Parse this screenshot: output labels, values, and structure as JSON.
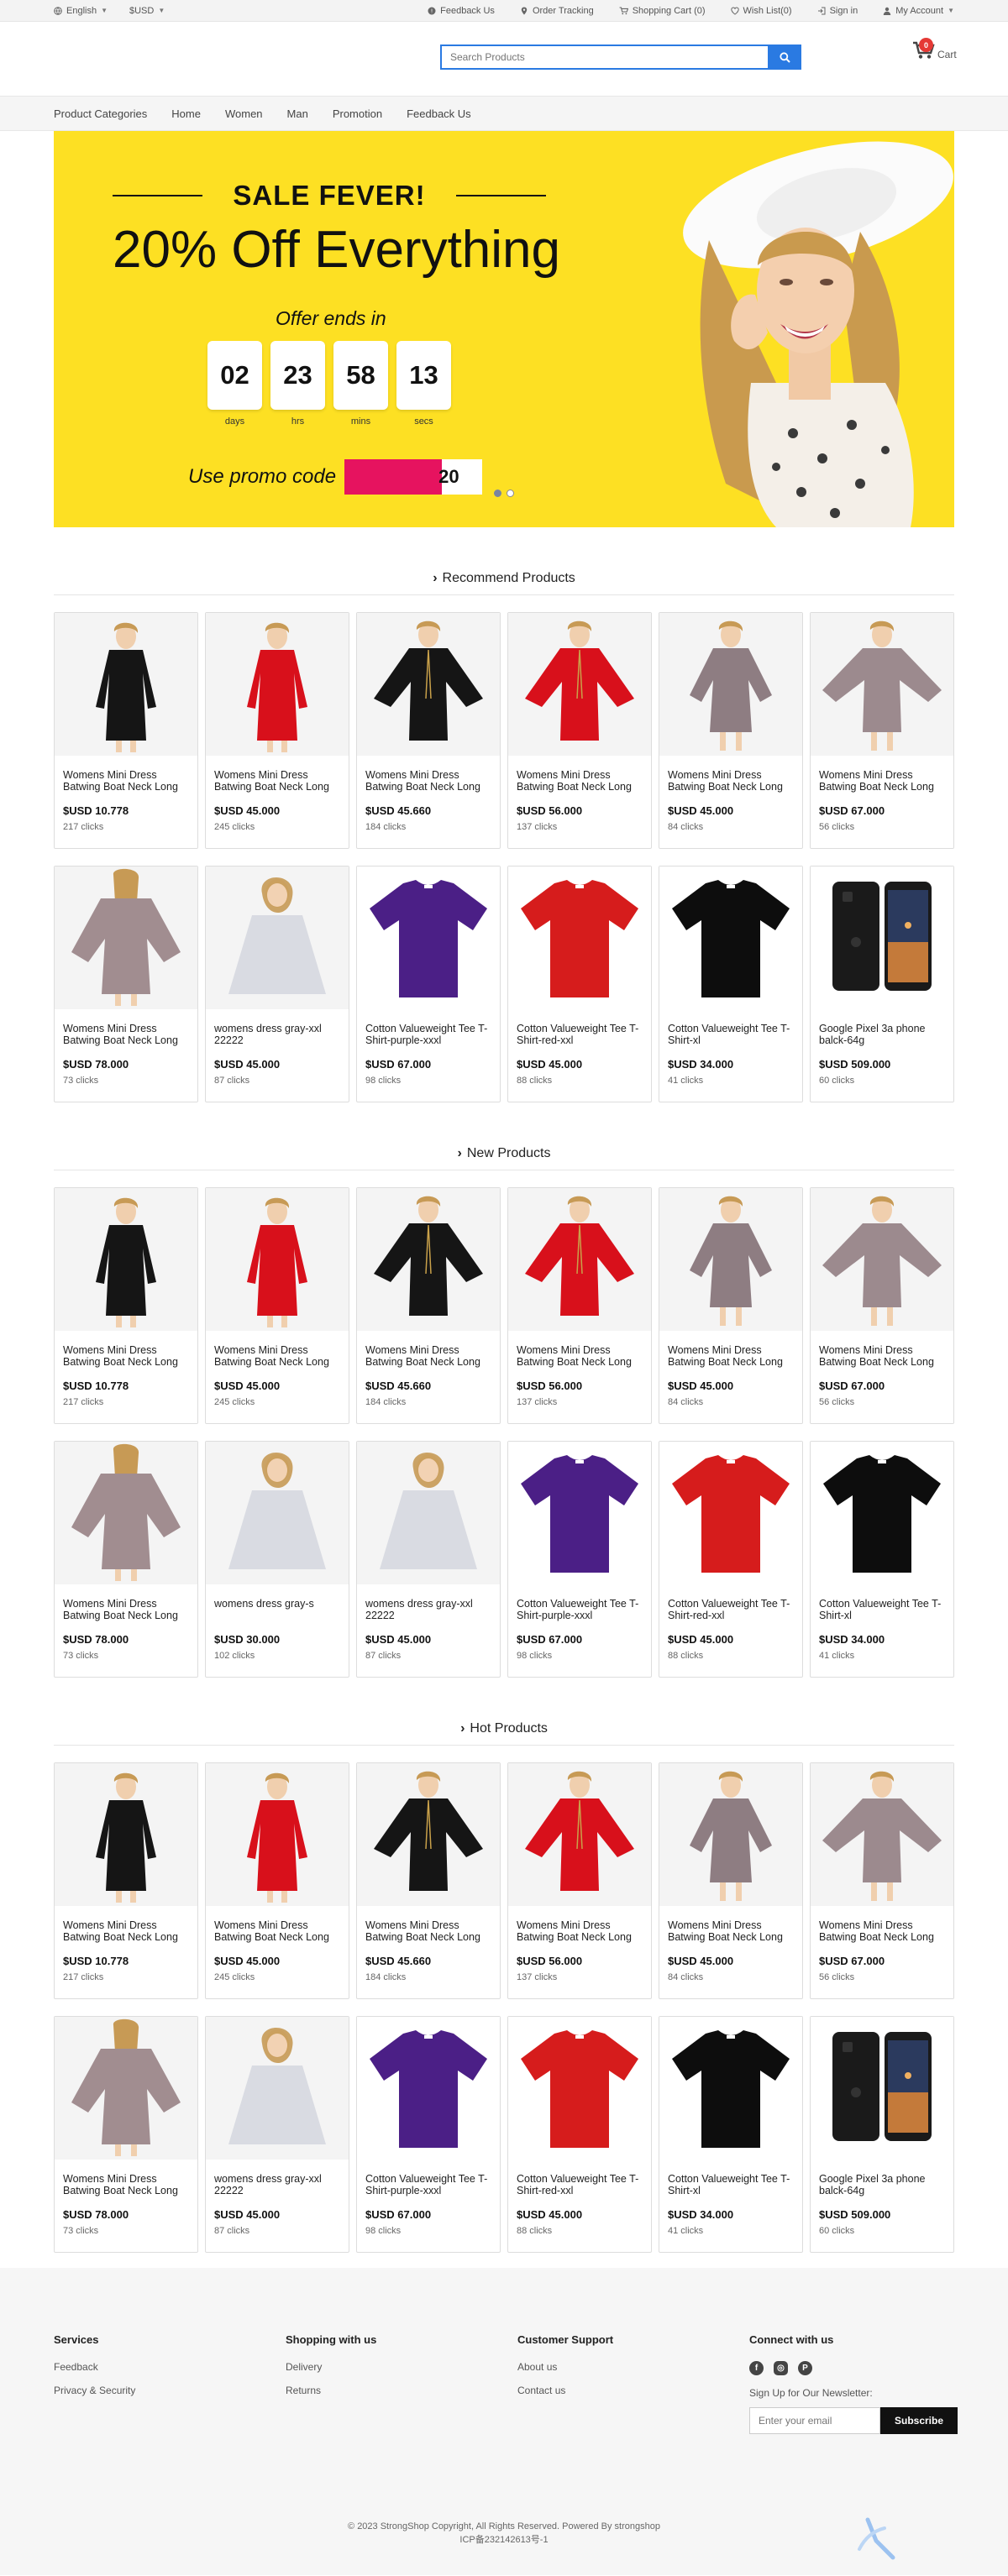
{
  "topbar": {
    "language": "English",
    "currency": "$USD",
    "feedback": "Feedback Us",
    "order_tracking": "Order Tracking",
    "cart": "Shopping Cart (0)",
    "wishlist": "Wish List(0)",
    "signin": "Sign in",
    "account": "My Account"
  },
  "header": {
    "search_placeholder": "Search Products",
    "cart_count": "0",
    "cart_label": "Cart"
  },
  "nav": [
    "Product Categories",
    "Home",
    "Women",
    "Man",
    "Promotion",
    "Feedback Us"
  ],
  "banner": {
    "sale_title": "SALE FEVER!",
    "headline": "20% Off Everything",
    "offer_ends": "Offer ends in",
    "countdown": [
      {
        "value": "02",
        "label": "days"
      },
      {
        "value": "23",
        "label": "hrs"
      },
      {
        "value": "58",
        "label": "mins"
      },
      {
        "value": "13",
        "label": "secs"
      }
    ],
    "promo_label": "Use promo code",
    "promo_code_visible": "20",
    "slides": 2,
    "active_slide": 1
  },
  "sections": [
    {
      "title": "Recommend Products",
      "products": [
        {
          "name": "Womens Mini Dress Batwing Boat Neck Long",
          "price": "$USD 10.778",
          "clicks": "217 clicks",
          "img": "dress-black"
        },
        {
          "name": "Womens Mini Dress Batwing Boat Neck Long",
          "price": "$USD 45.000",
          "clicks": "245 clicks",
          "img": "dress-red"
        },
        {
          "name": "Womens Mini Dress Batwing Boat Neck Long",
          "price": "$USD 45.660",
          "clicks": "184 clicks",
          "img": "dress-black-bat"
        },
        {
          "name": "Womens Mini Dress Batwing Boat Neck Long",
          "price": "$USD 56.000",
          "clicks": "137 clicks",
          "img": "dress-red-bat"
        },
        {
          "name": "Womens Mini Dress Batwing Boat Neck Long",
          "price": "$USD 45.000",
          "clicks": "84 clicks",
          "img": "dress-mauve"
        },
        {
          "name": "Womens Mini Dress Batwing Boat Neck Long",
          "price": "$USD 67.000",
          "clicks": "56 clicks",
          "img": "dress-mauve-bat"
        },
        {
          "name": "Womens Mini Dress Batwing Boat Neck Long",
          "price": "$USD 78.000",
          "clicks": "73 clicks",
          "img": "dress-mauve-back"
        },
        {
          "name": "womens dress gray-xxl 22222",
          "price": "$USD 45.000",
          "clicks": "87 clicks",
          "img": "dress-gray"
        },
        {
          "name": "Cotton Valueweight Tee T-Shirt-purple-xxxl",
          "price": "$USD 67.000",
          "clicks": "98 clicks",
          "img": "tee-purple"
        },
        {
          "name": "Cotton Valueweight Tee T-Shirt-red-xxl",
          "price": "$USD 45.000",
          "clicks": "88 clicks",
          "img": "tee-red"
        },
        {
          "name": "Cotton Valueweight Tee T-Shirt-xl",
          "price": "$USD 34.000",
          "clicks": "41 clicks",
          "img": "tee-black"
        },
        {
          "name": "Google Pixel 3a phone balck-64g",
          "price": "$USD 509.000",
          "clicks": "60 clicks",
          "img": "phone"
        }
      ]
    },
    {
      "title": "New Products",
      "products": [
        {
          "name": "Womens Mini Dress Batwing Boat Neck Long",
          "price": "$USD 10.778",
          "clicks": "217 clicks",
          "img": "dress-black"
        },
        {
          "name": "Womens Mini Dress Batwing Boat Neck Long",
          "price": "$USD 45.000",
          "clicks": "245 clicks",
          "img": "dress-red"
        },
        {
          "name": "Womens Mini Dress Batwing Boat Neck Long",
          "price": "$USD 45.660",
          "clicks": "184 clicks",
          "img": "dress-black-bat"
        },
        {
          "name": "Womens Mini Dress Batwing Boat Neck Long",
          "price": "$USD 56.000",
          "clicks": "137 clicks",
          "img": "dress-red-bat"
        },
        {
          "name": "Womens Mini Dress Batwing Boat Neck Long",
          "price": "$USD 45.000",
          "clicks": "84 clicks",
          "img": "dress-mauve"
        },
        {
          "name": "Womens Mini Dress Batwing Boat Neck Long",
          "price": "$USD 67.000",
          "clicks": "56 clicks",
          "img": "dress-mauve-bat"
        },
        {
          "name": "Womens Mini Dress Batwing Boat Neck Long",
          "price": "$USD 78.000",
          "clicks": "73 clicks",
          "img": "dress-mauve-back"
        },
        {
          "name": "womens dress gray-s",
          "price": "$USD 30.000",
          "clicks": "102 clicks",
          "img": "dress-gray"
        },
        {
          "name": "womens dress gray-xxl 22222",
          "price": "$USD 45.000",
          "clicks": "87 clicks",
          "img": "dress-gray"
        },
        {
          "name": "Cotton Valueweight Tee T-Shirt-purple-xxxl",
          "price": "$USD 67.000",
          "clicks": "98 clicks",
          "img": "tee-purple"
        },
        {
          "name": "Cotton Valueweight Tee T-Shirt-red-xxl",
          "price": "$USD 45.000",
          "clicks": "88 clicks",
          "img": "tee-red"
        },
        {
          "name": "Cotton Valueweight Tee T-Shirt-xl",
          "price": "$USD 34.000",
          "clicks": "41 clicks",
          "img": "tee-black"
        }
      ]
    },
    {
      "title": "Hot Products",
      "products": [
        {
          "name": "Womens Mini Dress Batwing Boat Neck Long",
          "price": "$USD 10.778",
          "clicks": "217 clicks",
          "img": "dress-black"
        },
        {
          "name": "Womens Mini Dress Batwing Boat Neck Long",
          "price": "$USD 45.000",
          "clicks": "245 clicks",
          "img": "dress-red"
        },
        {
          "name": "Womens Mini Dress Batwing Boat Neck Long",
          "price": "$USD 45.660",
          "clicks": "184 clicks",
          "img": "dress-black-bat"
        },
        {
          "name": "Womens Mini Dress Batwing Boat Neck Long",
          "price": "$USD 56.000",
          "clicks": "137 clicks",
          "img": "dress-red-bat"
        },
        {
          "name": "Womens Mini Dress Batwing Boat Neck Long",
          "price": "$USD 45.000",
          "clicks": "84 clicks",
          "img": "dress-mauve"
        },
        {
          "name": "Womens Mini Dress Batwing Boat Neck Long",
          "price": "$USD 67.000",
          "clicks": "56 clicks",
          "img": "dress-mauve-bat"
        },
        {
          "name": "Womens Mini Dress Batwing Boat Neck Long",
          "price": "$USD 78.000",
          "clicks": "73 clicks",
          "img": "dress-mauve-back"
        },
        {
          "name": "womens dress gray-xxl 22222",
          "price": "$USD 45.000",
          "clicks": "87 clicks",
          "img": "dress-gray"
        },
        {
          "name": "Cotton Valueweight Tee T-Shirt-purple-xxxl",
          "price": "$USD 67.000",
          "clicks": "98 clicks",
          "img": "tee-purple"
        },
        {
          "name": "Cotton Valueweight Tee T-Shirt-red-xxl",
          "price": "$USD 45.000",
          "clicks": "88 clicks",
          "img": "tee-red"
        },
        {
          "name": "Cotton Valueweight Tee T-Shirt-xl",
          "price": "$USD 34.000",
          "clicks": "41 clicks",
          "img": "tee-black"
        },
        {
          "name": "Google Pixel 3a phone balck-64g",
          "price": "$USD 509.000",
          "clicks": "60 clicks",
          "img": "phone"
        }
      ]
    }
  ],
  "footer": {
    "services": {
      "title": "Services",
      "links": [
        "Feedback",
        "Privacy & Security"
      ]
    },
    "shopping": {
      "title": "Shopping with us",
      "links": [
        "Delivery",
        "Returns"
      ]
    },
    "support": {
      "title": "Customer Support",
      "links": [
        "About us",
        "Contact us"
      ]
    },
    "connect": {
      "title": "Connect with us",
      "newsletter_label": "Sign Up for Our Newsletter:",
      "email_placeholder": "Enter your email",
      "subscribe": "Subscribe"
    },
    "copyright": "© 2023 StrongShop Copyright, All Rights Reserved. Powered By strongshop",
    "icp": "ICP备232142613号-1"
  },
  "colors": {
    "banner_bg": "#fde023",
    "accent_blue": "#2a7ae2",
    "promo_pink": "#e6135f",
    "badge_red": "#e53935"
  }
}
